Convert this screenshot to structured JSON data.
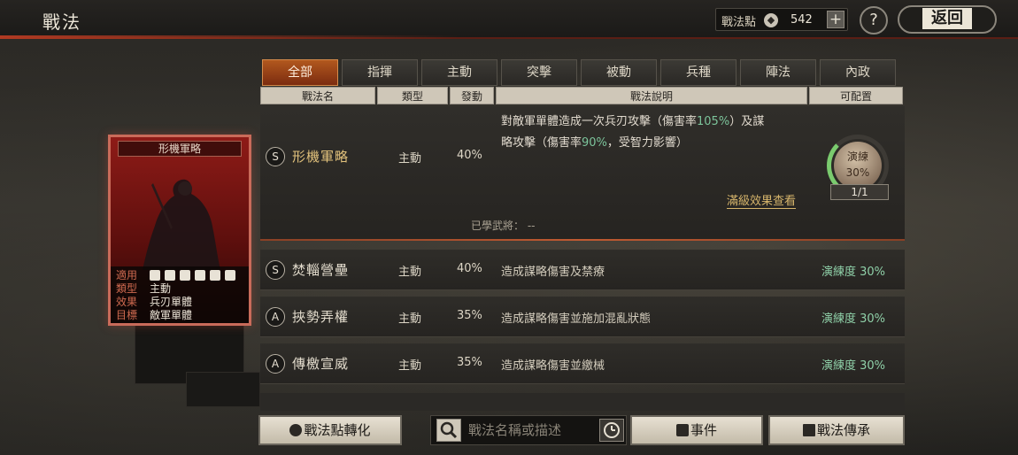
{
  "header": {
    "title": "戰法",
    "points_label": "戰法點",
    "points_value": "542",
    "plus_icon": "plus-icon",
    "help_label": "?",
    "back_label": "返回"
  },
  "card": {
    "name": "形機軍略",
    "rows": [
      {
        "key": "適用",
        "icons": [
          "cavalry-icon",
          "shield-icon",
          "shield-icon",
          "spear-icon",
          "sword-icon",
          "gear-icon"
        ]
      },
      {
        "key": "類型",
        "value": "主動"
      },
      {
        "key": "效果",
        "value": "兵刃單體"
      },
      {
        "key": "目標",
        "value": "敵軍單體"
      }
    ]
  },
  "tabs": [
    "全部",
    "指揮",
    "主動",
    "突擊",
    "被動",
    "兵種",
    "陣法",
    "內政"
  ],
  "active_tab": 0,
  "columns": [
    "戰法名",
    "類型",
    "發動",
    "戰法說明",
    "可配置"
  ],
  "selected": {
    "grade": "S",
    "name": "形機軍略",
    "type": "主動",
    "rate": "40%",
    "desc_a": "對敵軍單體造成一次兵刃攻擊（傷害率",
    "desc_b": "105%",
    "desc_c": "）及謀",
    "desc_d": "略攻擊（傷害率",
    "desc_e": "90%",
    "desc_f": "，受智力影響）",
    "view_full": "滿級效果查看",
    "learned": "已學武將：  --",
    "practice_label": "演練",
    "practice_value": "30%",
    "slots": "1/1"
  },
  "rows": [
    {
      "grade": "S",
      "name": "焚輜營壘",
      "type": "主動",
      "rate": "40%",
      "desc": "造成謀略傷害及禁療",
      "prof": "演練度 30%"
    },
    {
      "grade": "A",
      "name": "挾勢弄權",
      "type": "主動",
      "rate": "35%",
      "desc": "造成謀略傷害並施加混亂狀態",
      "prof": "演練度 30%"
    },
    {
      "grade": "A",
      "name": "傳檄宣威",
      "type": "主動",
      "rate": "35%",
      "desc": "造成謀略傷害並繳械",
      "prof": "演練度 30%"
    }
  ],
  "bottom": {
    "convert_label": "戰法點轉化",
    "search_placeholder": "戰法名稱或描述",
    "event_label": "事件",
    "inherit_label": "戰法傳承"
  },
  "colors": {
    "accent_red": "#c96b5a",
    "tab_active": "#b2581e",
    "highlight_green": "#7cc49b",
    "gold": "#d6b56b"
  }
}
